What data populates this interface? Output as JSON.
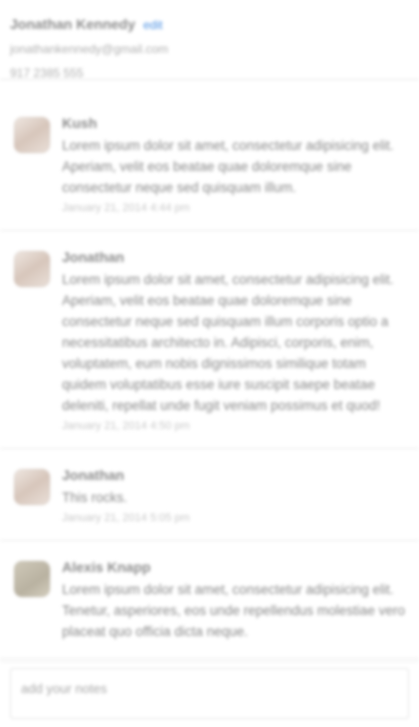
{
  "contact": {
    "name": "Jonathan Kennedy",
    "edit_label": "edit",
    "email": "jonathankennedy@gmail.com",
    "phone": "917 2385 555"
  },
  "notes": [
    {
      "author": "Kush",
      "avatar": "avatar-photo",
      "text": "Lorem ipsum dolor sit amet, consectetur adipisicing elit. Aperiam, velit eos beatae quae doloremque sine consectetur neque sed quisquam illum.",
      "time": "January 21, 2014 4:44 pm"
    },
    {
      "author": "Jonathan",
      "avatar": "avatar-photo",
      "text": "Lorem ipsum dolor sit amet, consectetur adipisicing elit. Aperiam, velit eos beatae quae doloremque sine consectetur neque sed quisquam illum corporis optio a necessitatibus architecto in. Adipisci, corporis, enim, voluptatem, eum nobis dignissimos similique totam quidem voluptatibus esse iure suscipit saepe beatae deleniti, repellat unde fugit veniam possimus et quod!",
      "time": "January 21, 2014 4:50 pm"
    },
    {
      "author": "Jonathan",
      "avatar": "avatar-photo",
      "text": "This rocks.",
      "time": "January 21, 2014 5:05 pm"
    },
    {
      "author": "Alexis Knapp",
      "avatar": "avatar-photo",
      "text": "Lorem ipsum dolor sit amet, consectetur adipisicing elit. Tenetur, asperiores, eos unde repellendus molestiae vero placeat quo officia dicta neque.",
      "time": ""
    }
  ],
  "composer": {
    "placeholder": "add your notes"
  }
}
